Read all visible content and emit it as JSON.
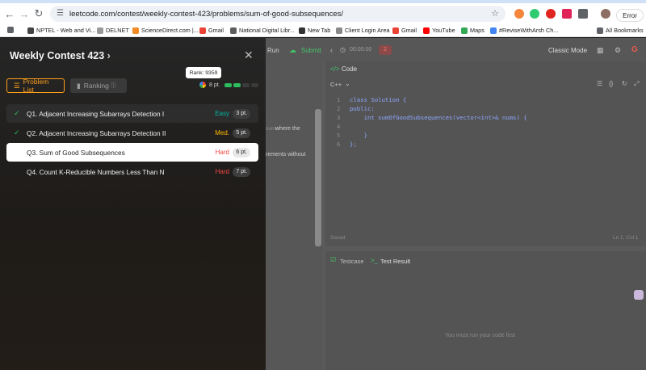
{
  "browser": {
    "url": "leetcode.com/contest/weekly-contest-423/problems/sum-of-good-subsequences/",
    "error_label": "Error",
    "bookmarks": [
      {
        "label": "NPTEL - Web and Vi...",
        "color": "#444444"
      },
      {
        "label": "DELNET",
        "color": "#999999"
      },
      {
        "label": "ScienceDirect.com |...",
        "color": "#f08a24"
      },
      {
        "label": "Gmail",
        "color": "#ea4335"
      },
      {
        "label": "National Digital Libr...",
        "color": "#5d5d5d"
      },
      {
        "label": "New Tab",
        "color": "#333333"
      },
      {
        "label": "Client Login Area",
        "color": "#888888"
      },
      {
        "label": "Gmail",
        "color": "#ea4335"
      },
      {
        "label": "YouTube",
        "color": "#ff0000"
      },
      {
        "label": "Maps",
        "color": "#34a853"
      },
      {
        "label": "#ReviseWithArsh Ch...",
        "color": "#4285f4"
      }
    ],
    "all_bookmarks": "All Bookmarks"
  },
  "panel": {
    "title": "Weekly Contest 423",
    "tabs": {
      "problem_list": "Problem List",
      "ranking": "Ranking"
    },
    "rank_tooltip": "Rank: 9359",
    "points": "8 pt.",
    "problems": [
      {
        "name": "Q1. Adjacent Increasing Subarrays Detection I",
        "difficulty": "Easy",
        "diff_color": "#00b8a3",
        "points": "3 pt.",
        "solved": true
      },
      {
        "name": "Q2. Adjacent Increasing Subarrays Detection II",
        "difficulty": "Med.",
        "diff_color": "#ffb800",
        "points": "5 pt.",
        "solved": true
      },
      {
        "name": "Q3. Sum of Good Subsequences",
        "difficulty": "Hard",
        "diff_color": "#ef4743",
        "points": "6 pt.",
        "solved": false
      },
      {
        "name": "Q4. Count K-Reducible Numbers Less Than N",
        "difficulty": "Hard",
        "diff_color": "#ef4743",
        "points": "7 pt.",
        "solved": false
      }
    ]
  },
  "workspace": {
    "run": "Run",
    "submit": "Submit",
    "timer": "00:00:00",
    "badge": "2",
    "classic_mode": "Classic Mode",
    "code_tab": "Code",
    "language": "C++",
    "saved": "Saved",
    "cursor": "Ln 1, Col 1",
    "testcase_tab": "Testcase",
    "test_result_tab": "Test Result",
    "empty_msg": "You must run your code first",
    "desc_fragment_1": "where the",
    "desc_fragment_2": "rements without",
    "desc_fragment_0": "nums",
    "code_lines": [
      {
        "num": "1",
        "text": "class Solution {"
      },
      {
        "num": "2",
        "text": "public:"
      },
      {
        "num": "3",
        "text": "    int sumOfGoodSubsequences(vector<int>& nums) {"
      },
      {
        "num": "4",
        "text": ""
      },
      {
        "num": "5",
        "text": "    }"
      },
      {
        "num": "6",
        "text": "};"
      }
    ]
  }
}
